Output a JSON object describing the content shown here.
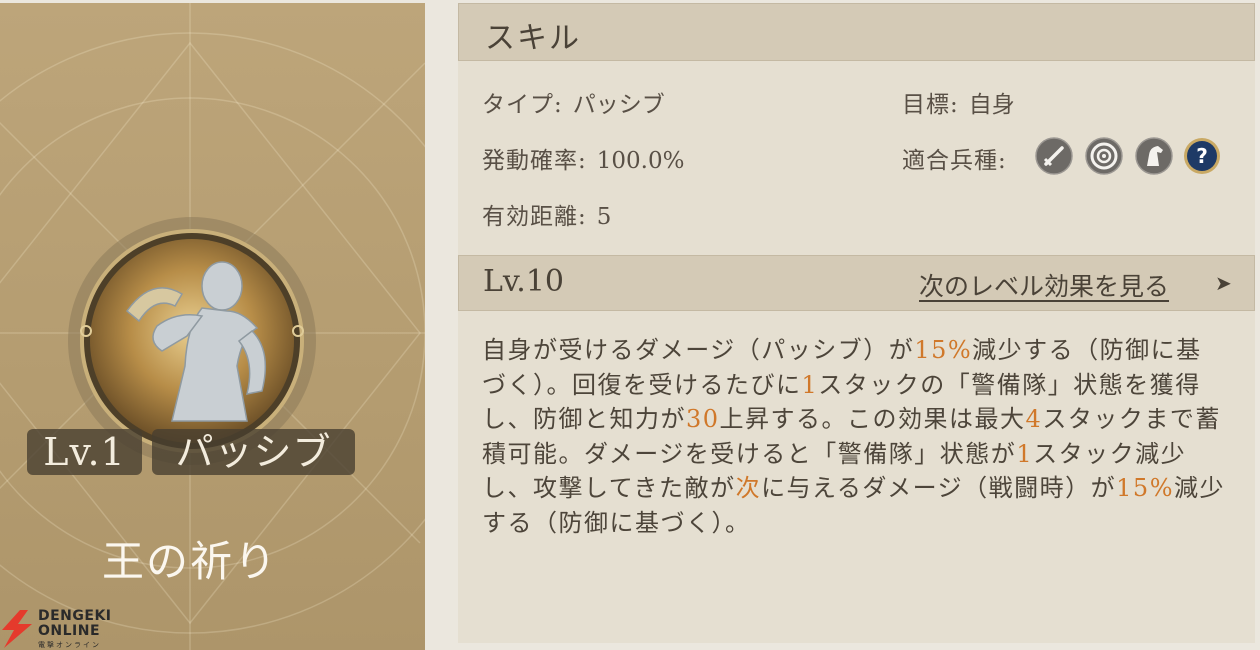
{
  "skill": {
    "name": "王の祈り",
    "level_badge": "Lv.1",
    "type_badge": "パッシブ"
  },
  "header": {
    "title": "スキル"
  },
  "info": {
    "type_label": "タイプ:",
    "type_value": "パッシブ",
    "target_label": "目標:",
    "target_value": "自身",
    "rate_label": "発動確率:",
    "rate_value": "100.0%",
    "troops_label": "適合兵種:",
    "range_label": "有効距離:",
    "range_value": "5",
    "troop_icons": [
      "sword-icon",
      "target-bow-icon",
      "horse-icon",
      "question-icon"
    ]
  },
  "level_section": {
    "level": "Lv.10",
    "next_link": "次のレベル効果を見る",
    "arrow": "➤"
  },
  "description": {
    "p1": "自身が受けるダメージ（パッシブ）が",
    "h1": "15%",
    "p2": "減少する（防御に基づく）。回復を受けるたびに",
    "h2": "1",
    "p3": "スタックの「警備隊」状態を獲得し、防御と知力が",
    "h3": "30",
    "p4": "上昇する。この効果は最大",
    "h4": "4",
    "p5": "スタックまで蓄積可能。ダメージを受けると「警備隊」状態が",
    "h5": "1",
    "p6": "スタック減少し、攻撃してきた敵が",
    "h6": "次",
    "p7": "に与えるダメージ（戦闘時）が",
    "h7": "15%",
    "p8": "減少する（防御に基づく）。"
  },
  "watermark": {
    "line1": "DENGEKI",
    "line2": "ONLINE",
    "line3": "電撃オンライン"
  },
  "colors": {
    "highlight": "#d0782a",
    "card": "#b49c70",
    "panel": "#e5dfd1",
    "bar": "#d4cab6"
  }
}
